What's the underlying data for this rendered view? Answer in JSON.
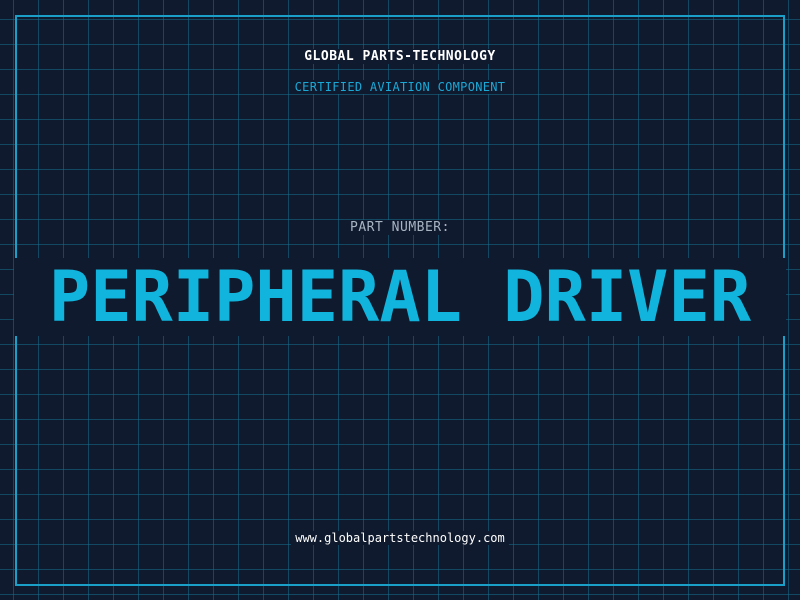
{
  "header": {
    "company": "GLOBAL PARTS-TECHNOLOGY",
    "tagline": "CERTIFIED AVIATION COMPONENT"
  },
  "part": {
    "label": "PART NUMBER:",
    "name": "PERIPHERAL DRIVER"
  },
  "footer": {
    "url": "www.globalpartstechnology.com"
  },
  "colors": {
    "background": "#0f1a2e",
    "grid": "#156e8c",
    "accent": "#1aa8d6",
    "part_name": "#10b4dc",
    "text": "#ffffff",
    "label": "#a9b4c2"
  }
}
